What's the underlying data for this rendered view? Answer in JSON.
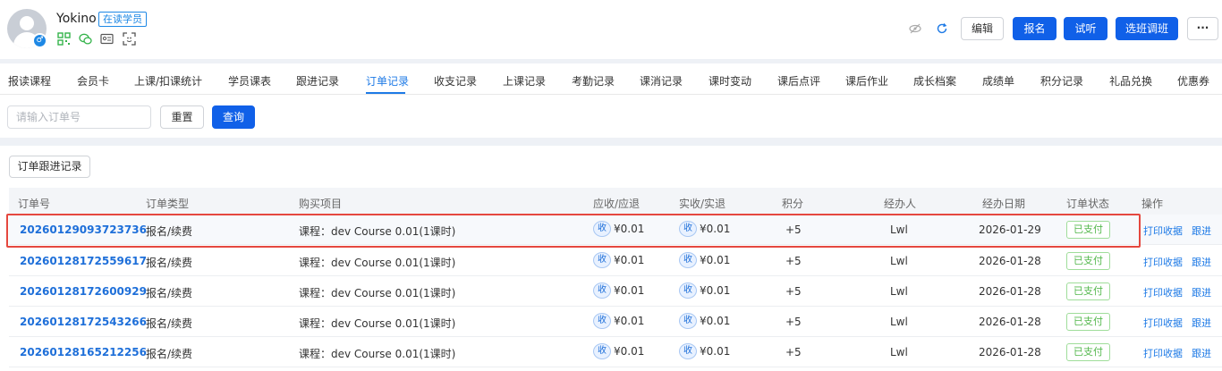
{
  "header": {
    "user_name": "Yokino",
    "student_badge": "在读学员",
    "gender_symbol": "♂",
    "icons": [
      "qrcode-icon",
      "wechat-icon",
      "id-card-icon",
      "scan-icon"
    ],
    "tools": [
      "eye-hidden-icon",
      "refresh-icon"
    ],
    "buttons": {
      "edit": "编辑",
      "enroll": "报名",
      "trial": "试听",
      "transfer": "选班调班",
      "more": "···"
    }
  },
  "tabs": [
    "报读课程",
    "会员卡",
    "上课/扣课统计",
    "学员课表",
    "跟进记录",
    "订单记录",
    "收支记录",
    "上课记录",
    "考勤记录",
    "课消记录",
    "课时变动",
    "课后点评",
    "课后作业",
    "成长档案",
    "成绩单",
    "积分记录",
    "礼品兑换",
    "优惠券"
  ],
  "active_tab": "订单记录",
  "filter": {
    "order_placeholder": "请输入订单号",
    "reset": "重置",
    "search": "查询"
  },
  "follow_button": "订单跟进记录",
  "table": {
    "columns": [
      "订单号",
      "订单类型",
      "购买项目",
      "应收/应退",
      "实收/实退",
      "积分",
      "经办人",
      "经办日期",
      "订单状态",
      "操作"
    ],
    "receive_tag": "收",
    "actions": {
      "print": "打印收据",
      "follow": "跟进"
    },
    "rows": [
      {
        "order_no": "20260129093723736",
        "type": "报名/续费",
        "item": "课程：dev Course 0.01(1课时)",
        "due": "¥0.01",
        "paid": "¥0.01",
        "points": "+5",
        "handler": "Lwl",
        "date": "2026-01-29",
        "status": "已支付"
      },
      {
        "order_no": "20260128172559617",
        "type": "报名/续费",
        "item": "课程：dev Course 0.01(1课时)",
        "due": "¥0.01",
        "paid": "¥0.01",
        "points": "+5",
        "handler": "Lwl",
        "date": "2026-01-28",
        "status": "已支付"
      },
      {
        "order_no": "20260128172600929",
        "type": "报名/续费",
        "item": "课程：dev Course 0.01(1课时)",
        "due": "¥0.01",
        "paid": "¥0.01",
        "points": "+5",
        "handler": "Lwl",
        "date": "2026-01-28",
        "status": "已支付"
      },
      {
        "order_no": "20260128172543266",
        "type": "报名/续费",
        "item": "课程：dev Course 0.01(1课时)",
        "due": "¥0.01",
        "paid": "¥0.01",
        "points": "+5",
        "handler": "Lwl",
        "date": "2026-01-28",
        "status": "已支付"
      },
      {
        "order_no": "20260128165212256",
        "type": "报名/续费",
        "item": "课程：dev Course 0.01(1课时)",
        "due": "¥0.01",
        "paid": "¥0.01",
        "points": "+5",
        "handler": "Lwl",
        "date": "2026-01-28",
        "status": "已支付"
      }
    ]
  },
  "colors": {
    "primary": "#1060e8",
    "link": "#1e6fd9",
    "paid_green": "#55b84e",
    "highlight_red": "#e5483f"
  }
}
